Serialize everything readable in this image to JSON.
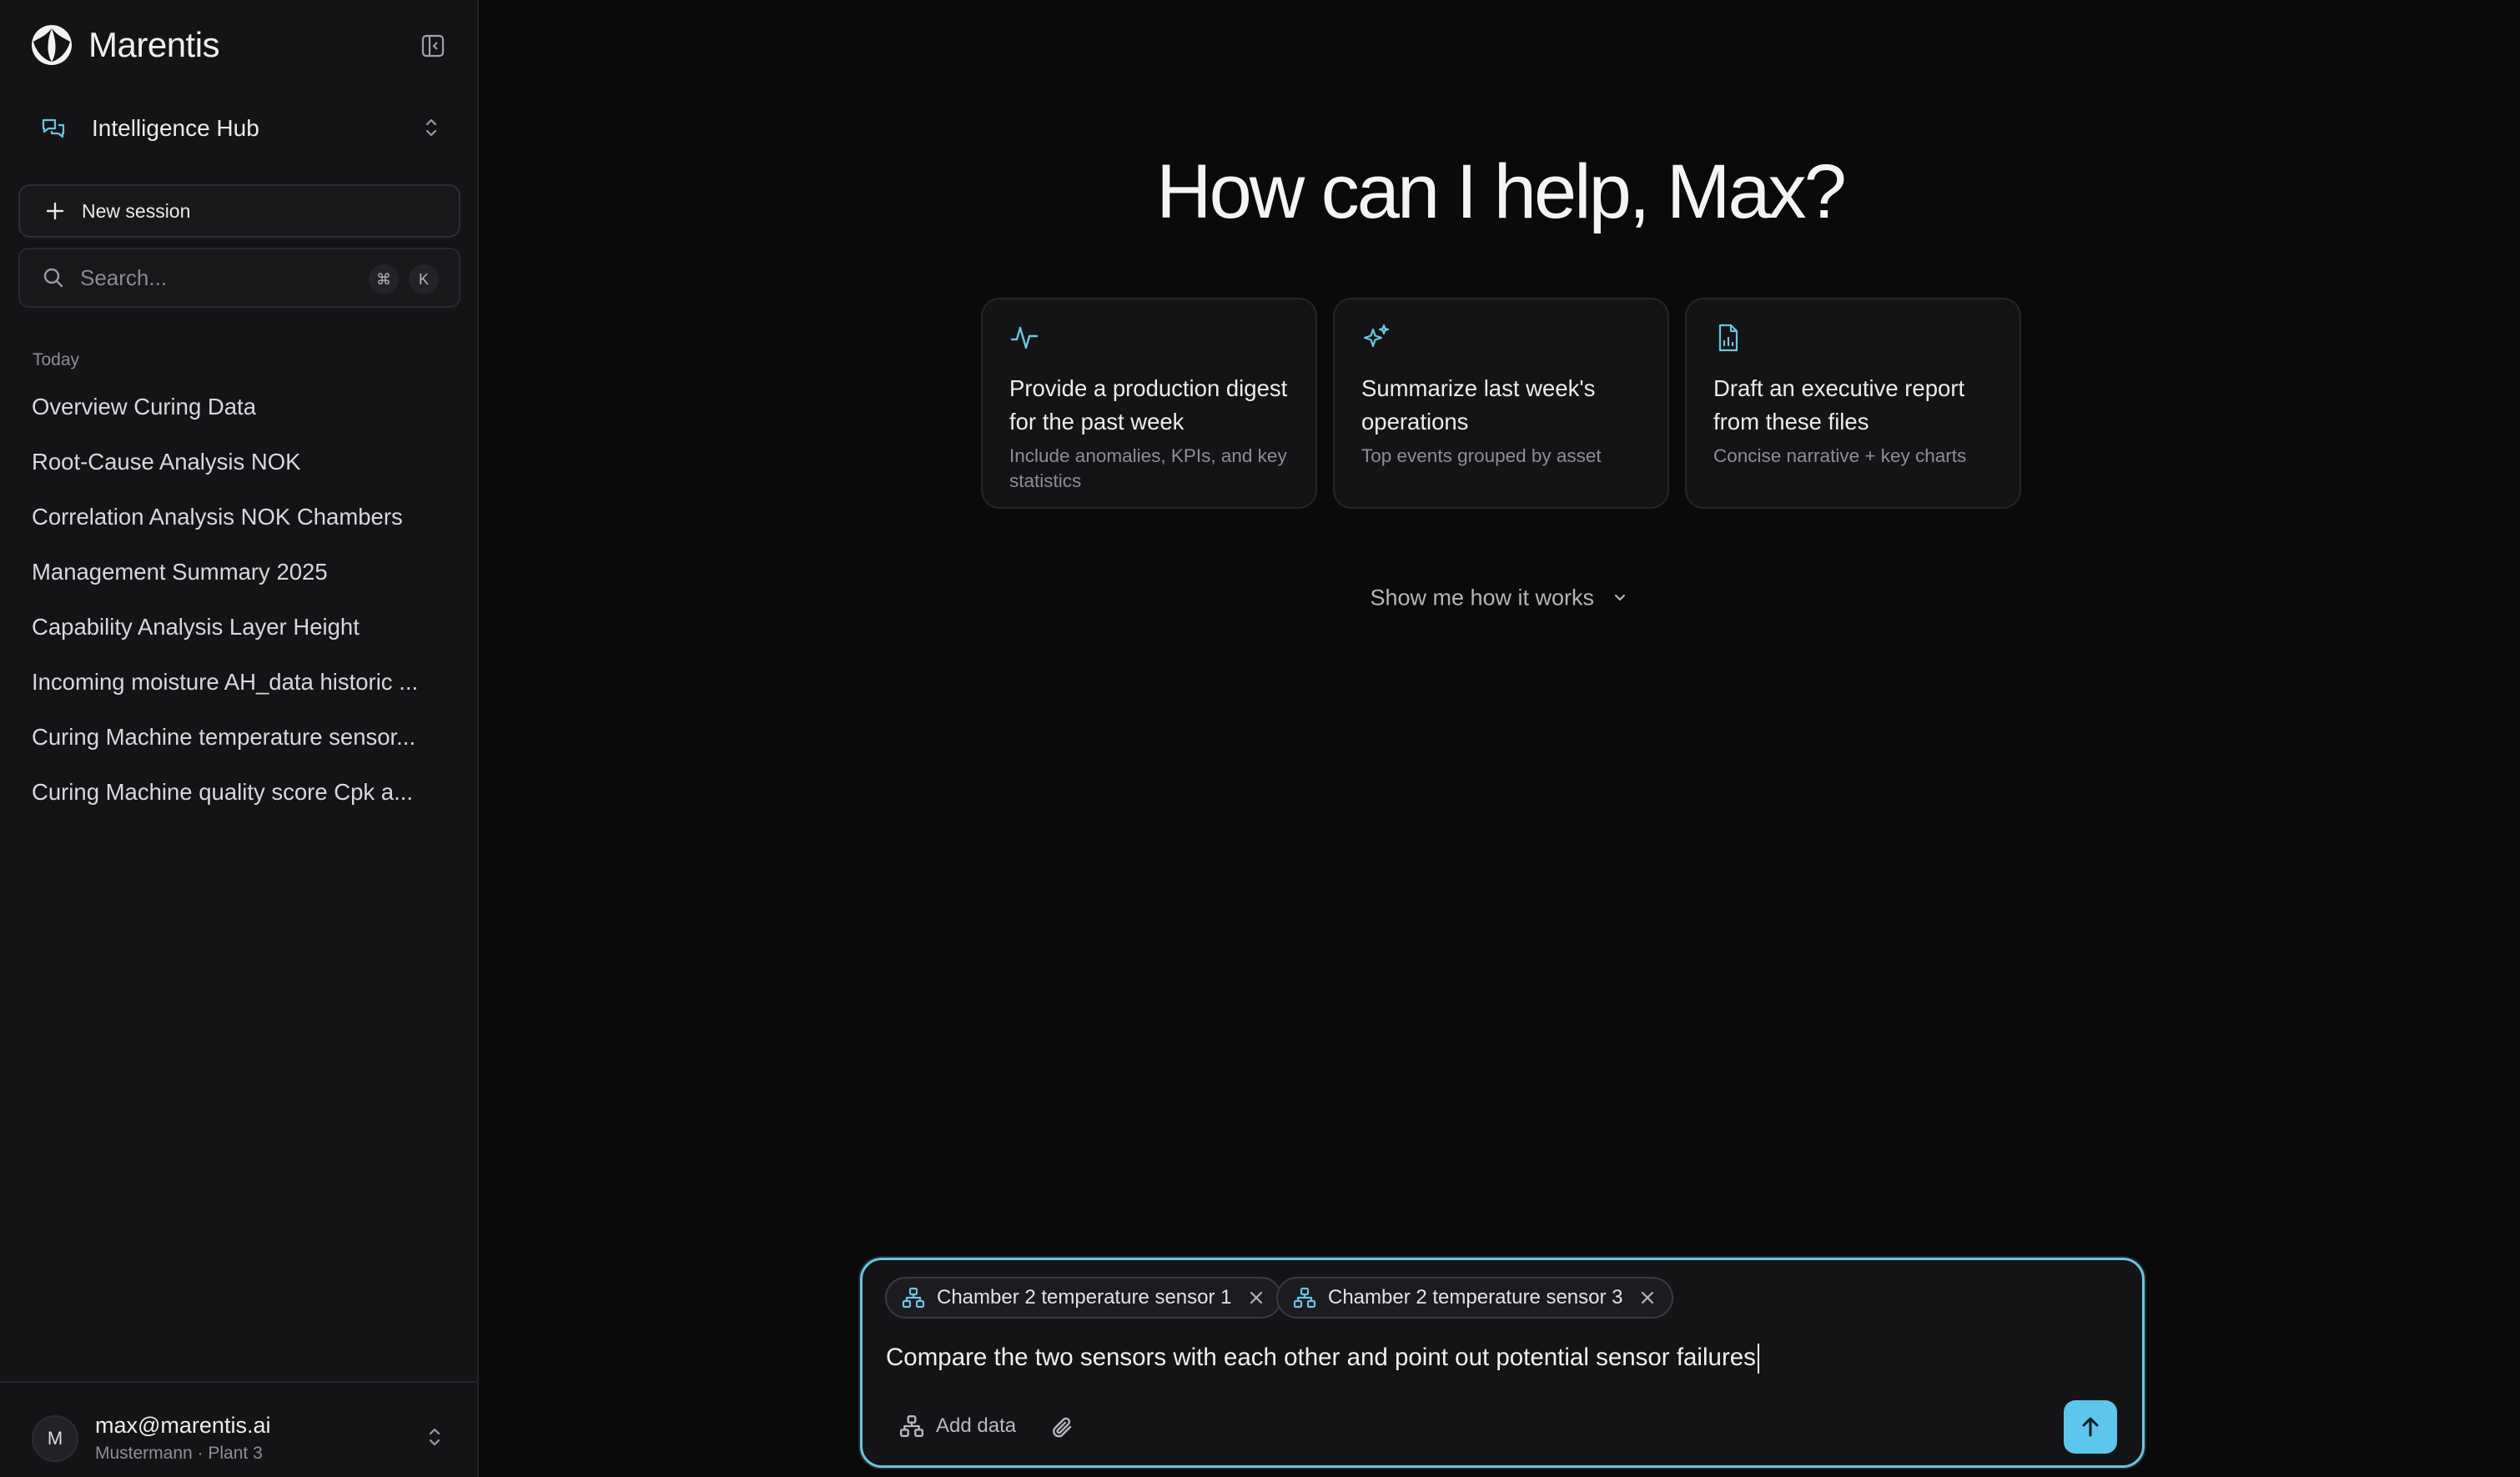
{
  "app": {
    "name": "Marentis"
  },
  "sidebar": {
    "workspace": "Intelligence Hub",
    "new_session_label": "New session",
    "search": {
      "placeholder": "Search...",
      "shortcut": [
        "⌘",
        "K"
      ]
    },
    "section_label": "Today",
    "history": [
      "Overview Curing Data",
      "Root-Cause Analysis NOK",
      "Correlation Analysis NOK Chambers",
      "Management Summary 2025",
      "Capability Analysis Layer Height",
      "Incoming moisture AH_data historic ...",
      "Curing Machine temperature sensor...",
      "Curing Machine quality score Cpk a..."
    ],
    "user": {
      "initial": "M",
      "email": "max@marentis.ai",
      "subtitle": "Mustermann · Plant 3"
    }
  },
  "main": {
    "greeting": "How can I help, Max?",
    "cards": [
      {
        "icon": "activity-icon",
        "title": "Provide a production digest for the past week",
        "subtitle": "Include anomalies, KPIs, and key statistics"
      },
      {
        "icon": "sparkles-icon",
        "title": "Summarize last week's operations",
        "subtitle": "Top events grouped by asset"
      },
      {
        "icon": "file-chart-icon",
        "title": "Draft an executive report from these files",
        "subtitle": "Concise narrative + key charts"
      }
    ],
    "how_it_works": "Show me how it works"
  },
  "composer": {
    "chips": [
      "Chamber 2 temperature sensor 1",
      "Chamber 2 temperature sensor 3"
    ],
    "text": "Compare the two sensors with each other and point out potential sensor failures",
    "add_data_label": "Add data"
  },
  "colors": {
    "accent": "#5cc6ec",
    "background": "#0a0a0b",
    "sidebar": "#141416"
  }
}
